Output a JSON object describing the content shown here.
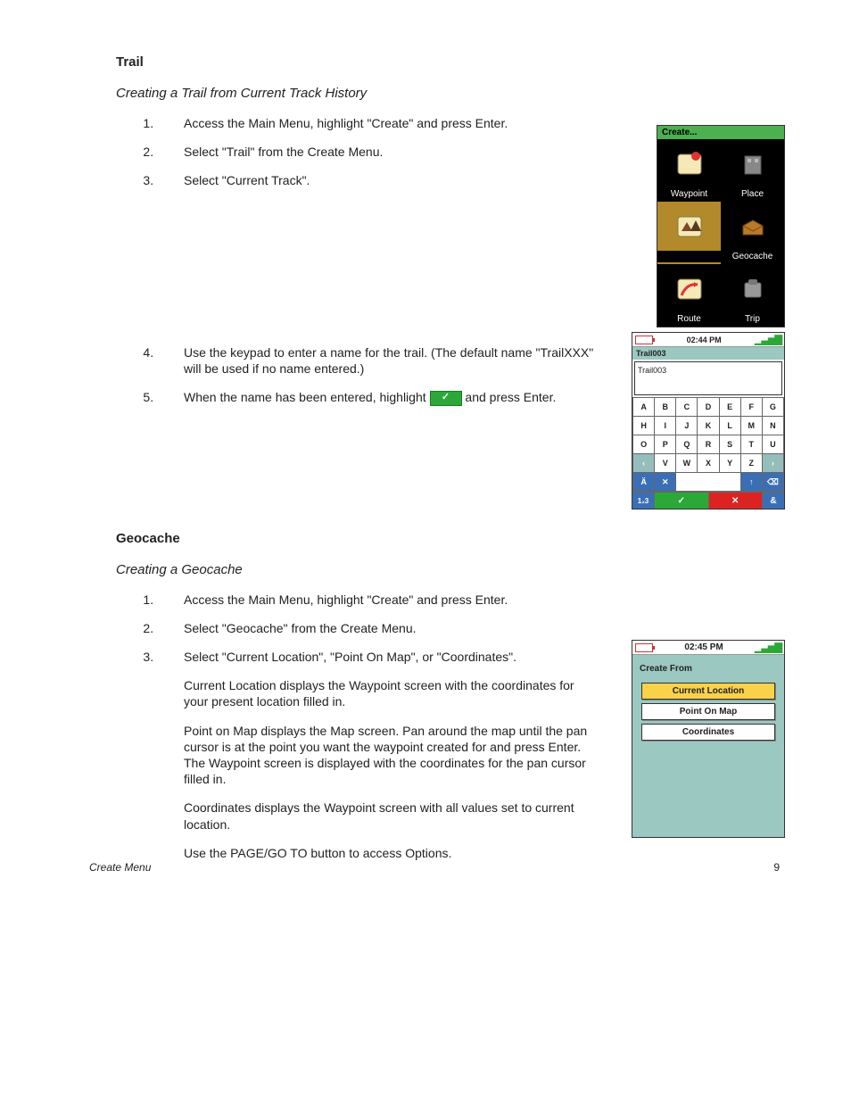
{
  "sections": {
    "trail": {
      "title": "Trail",
      "subtitle": "Creating a Trail from Current Track History",
      "steps": {
        "s1": "Access the Main Menu, highlight \"Create\" and press Enter.",
        "s2": "Select \"Trail\" from the Create Menu.",
        "s3": "Select \"Current Track\".",
        "s4": "Use the keypad to enter a name for the trail. (The default name \"TrailXXX\" will be used if no name entered.)",
        "s5a": "When the name has been entered, highlight ",
        "s5b": " and press Enter."
      }
    },
    "geocache": {
      "title": "Geocache",
      "subtitle": "Creating a Geocache",
      "steps": {
        "s1": "Access the Main Menu, highlight \"Create\" and press Enter.",
        "s2": "Select \"Geocache\" from the Create Menu.",
        "s3": "Select \"Current Location\", \"Point On Map\", or \"Coordinates\"."
      },
      "paras": {
        "p1": "Current Location displays the Waypoint screen with the coordinates for your present location filled in.",
        "p2": "Point on Map displays the Map screen. Pan around the map until the pan cursor is at the point you want the waypoint created for and press Enter. The Waypoint screen is displayed with the coordinates for the pan cursor filled in.",
        "p3": "Coordinates displays the Waypoint screen with all values set to current location.",
        "p4": "Use the PAGE/GO TO button to access Options."
      }
    }
  },
  "device_create": {
    "title": "Create...",
    "items": [
      "Waypoint",
      "Place",
      "Trail",
      "Geocache",
      "Route",
      "Trip"
    ],
    "selected": "Trail"
  },
  "device_keypad": {
    "time": "02:44 PM",
    "field_label": "Trail003",
    "entry_value": "Trail003",
    "rows": [
      [
        "A",
        "B",
        "C",
        "D",
        "E",
        "F",
        "G"
      ],
      [
        "H",
        "I",
        "J",
        "K",
        "L",
        "M",
        "N"
      ],
      [
        "O",
        "P",
        "Q",
        "R",
        "S",
        "T",
        "U"
      ]
    ],
    "row4": [
      "‹",
      "V",
      "W",
      "X",
      "Y",
      "Z",
      "›"
    ],
    "row5": [
      "Ä",
      "✕",
      "",
      "",
      "",
      "↑",
      "⌫"
    ],
    "bottom": {
      "num": "1₂3",
      "ok": "✓",
      "cancel": "✕",
      "amp": "&"
    }
  },
  "device_cfrom": {
    "time": "02:45 PM",
    "heading": "Create From",
    "options": [
      "Current Location",
      "Point On Map",
      "Coordinates"
    ],
    "selected": "Current Location"
  },
  "footer": {
    "section": "Create Menu",
    "page": "9"
  }
}
